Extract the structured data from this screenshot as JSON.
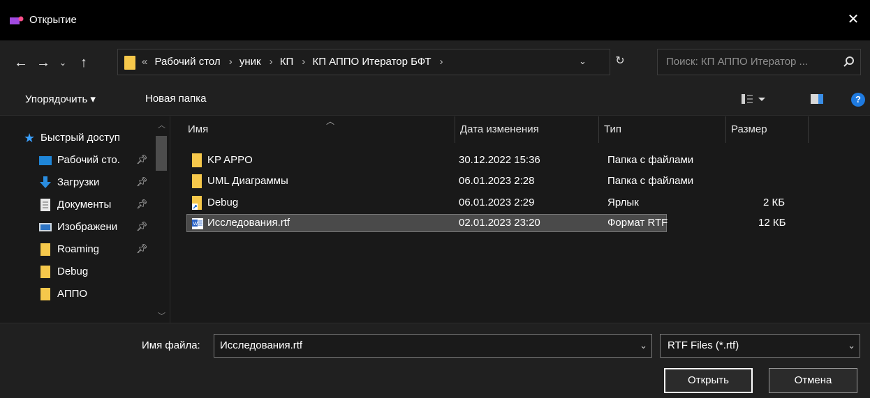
{
  "window": {
    "title": "Открытие",
    "close_glyph": "✕",
    "accent": "#1e7ae0"
  },
  "address": {
    "crumbs": [
      "«",
      "Рабочий стол",
      "уник",
      "КП",
      "КП АППО Итератор БФТ"
    ],
    "separator": "›",
    "search_placeholder": "Поиск: КП АППО Итератор ..."
  },
  "toolbar": {
    "organize": "Упорядочить ▾",
    "new_folder": "Новая папка"
  },
  "sidebar": {
    "items": [
      {
        "label": "Быстрый доступ",
        "icon": "star-icon",
        "pinned": false
      },
      {
        "label": "Рабочий сто.",
        "icon": "desktop-icon",
        "pinned": true
      },
      {
        "label": "Загрузки",
        "icon": "download-icon",
        "pinned": true
      },
      {
        "label": "Документы",
        "icon": "document-icon",
        "pinned": true
      },
      {
        "label": "Изображени",
        "icon": "image-icon",
        "pinned": true
      },
      {
        "label": "Roaming",
        "icon": "folder-icon",
        "pinned": true
      },
      {
        "label": "Debug",
        "icon": "folder-icon",
        "pinned": false
      },
      {
        "label": "АППО",
        "icon": "folder-icon",
        "pinned": false
      }
    ]
  },
  "columns": {
    "name": "Имя",
    "date": "Дата изменения",
    "type": "Тип",
    "size": "Размер"
  },
  "files": [
    {
      "name": "KP APPO",
      "date": "30.12.2022 15:36",
      "type": "Папка с файлами",
      "size": "",
      "icon": "folder-icon"
    },
    {
      "name": "UML Диаграммы",
      "date": "06.01.2023 2:28",
      "type": "Папка с файлами",
      "size": "",
      "icon": "folder-icon"
    },
    {
      "name": "Debug",
      "date": "06.01.2023 2:29",
      "type": "Ярлык",
      "size": "2 КБ",
      "icon": "shortcut-icon"
    },
    {
      "name": "Исследования.rtf",
      "date": "02.01.2023 23:20",
      "type": "Формат RTF",
      "size": "12 КБ",
      "icon": "rtf-file-icon",
      "selected": true
    }
  ],
  "footer": {
    "filename_label": "Имя файла:",
    "filename_value": "Исследования.rtf",
    "filetype": "RTF Files (*.rtf)",
    "open_button": "Открыть",
    "cancel_button": "Отмена"
  }
}
